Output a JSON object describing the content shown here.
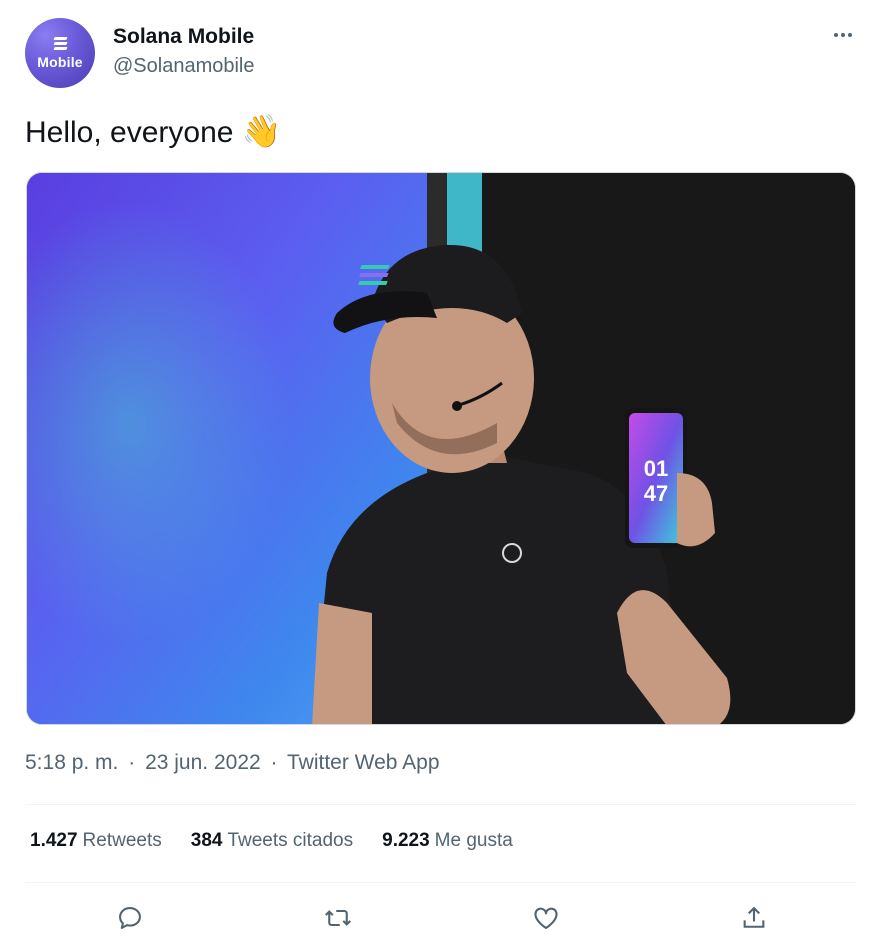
{
  "author": {
    "name": "Solana Mobile",
    "handle": "@Solanamobile",
    "avatar_text": "Mobile"
  },
  "tweet": {
    "text": "Hello, everyone",
    "emoji": "👋"
  },
  "meta": {
    "time": "5:18 p. m.",
    "date": "23 jun. 2022",
    "source": "Twitter Web App",
    "separator": "·"
  },
  "media": {
    "phone_clock_hour": "01",
    "phone_clock_minute": "47"
  },
  "stats": [
    {
      "count": "1.427",
      "label": "Retweets"
    },
    {
      "count": "384",
      "label": "Tweets citados"
    },
    {
      "count": "9.223",
      "label": "Me gusta"
    }
  ],
  "icons": {
    "more": "more-icon",
    "reply": "reply-icon",
    "retweet": "retweet-icon",
    "like": "heart-icon",
    "share": "share-icon"
  },
  "colors": {
    "text_primary": "#0f1419",
    "text_secondary": "#536471",
    "divider": "#eff3f4"
  }
}
